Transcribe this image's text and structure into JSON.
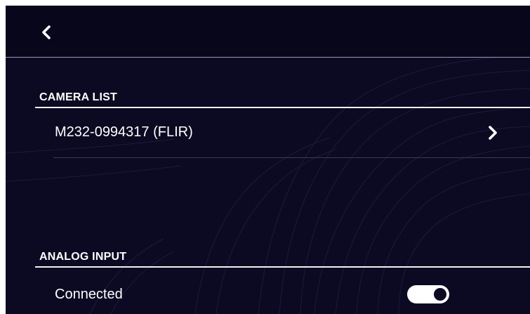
{
  "colors": {
    "background": "#0b0a22",
    "header": "#07061a",
    "text": "#ffffff",
    "divider": "#3a3a55"
  },
  "header": {
    "back_icon": "chevron-left-icon"
  },
  "camera_list": {
    "title": "CAMERA LIST",
    "items": [
      {
        "label": "M232-0994317 (FLIR)",
        "icon": "chevron-right-icon"
      }
    ]
  },
  "analog_input": {
    "title": "ANALOG INPUT",
    "connected": {
      "label": "Connected",
      "enabled": true
    }
  }
}
